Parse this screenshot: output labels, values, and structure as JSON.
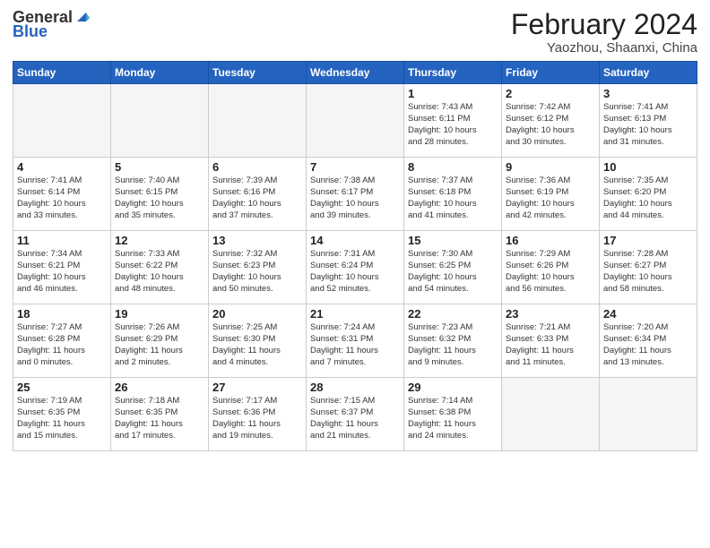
{
  "header": {
    "logo_general": "General",
    "logo_blue": "Blue",
    "title": "February 2024",
    "subtitle": "Yaozhou, Shaanxi, China"
  },
  "days_of_week": [
    "Sunday",
    "Monday",
    "Tuesday",
    "Wednesday",
    "Thursday",
    "Friday",
    "Saturday"
  ],
  "weeks": [
    [
      {
        "day": "",
        "info": "",
        "empty": true
      },
      {
        "day": "",
        "info": "",
        "empty": true
      },
      {
        "day": "",
        "info": "",
        "empty": true
      },
      {
        "day": "",
        "info": "",
        "empty": true
      },
      {
        "day": "1",
        "info": "Sunrise: 7:43 AM\nSunset: 6:11 PM\nDaylight: 10 hours\nand 28 minutes.",
        "empty": false
      },
      {
        "day": "2",
        "info": "Sunrise: 7:42 AM\nSunset: 6:12 PM\nDaylight: 10 hours\nand 30 minutes.",
        "empty": false
      },
      {
        "day": "3",
        "info": "Sunrise: 7:41 AM\nSunset: 6:13 PM\nDaylight: 10 hours\nand 31 minutes.",
        "empty": false
      }
    ],
    [
      {
        "day": "4",
        "info": "Sunrise: 7:41 AM\nSunset: 6:14 PM\nDaylight: 10 hours\nand 33 minutes.",
        "empty": false
      },
      {
        "day": "5",
        "info": "Sunrise: 7:40 AM\nSunset: 6:15 PM\nDaylight: 10 hours\nand 35 minutes.",
        "empty": false
      },
      {
        "day": "6",
        "info": "Sunrise: 7:39 AM\nSunset: 6:16 PM\nDaylight: 10 hours\nand 37 minutes.",
        "empty": false
      },
      {
        "day": "7",
        "info": "Sunrise: 7:38 AM\nSunset: 6:17 PM\nDaylight: 10 hours\nand 39 minutes.",
        "empty": false
      },
      {
        "day": "8",
        "info": "Sunrise: 7:37 AM\nSunset: 6:18 PM\nDaylight: 10 hours\nand 41 minutes.",
        "empty": false
      },
      {
        "day": "9",
        "info": "Sunrise: 7:36 AM\nSunset: 6:19 PM\nDaylight: 10 hours\nand 42 minutes.",
        "empty": false
      },
      {
        "day": "10",
        "info": "Sunrise: 7:35 AM\nSunset: 6:20 PM\nDaylight: 10 hours\nand 44 minutes.",
        "empty": false
      }
    ],
    [
      {
        "day": "11",
        "info": "Sunrise: 7:34 AM\nSunset: 6:21 PM\nDaylight: 10 hours\nand 46 minutes.",
        "empty": false
      },
      {
        "day": "12",
        "info": "Sunrise: 7:33 AM\nSunset: 6:22 PM\nDaylight: 10 hours\nand 48 minutes.",
        "empty": false
      },
      {
        "day": "13",
        "info": "Sunrise: 7:32 AM\nSunset: 6:23 PM\nDaylight: 10 hours\nand 50 minutes.",
        "empty": false
      },
      {
        "day": "14",
        "info": "Sunrise: 7:31 AM\nSunset: 6:24 PM\nDaylight: 10 hours\nand 52 minutes.",
        "empty": false
      },
      {
        "day": "15",
        "info": "Sunrise: 7:30 AM\nSunset: 6:25 PM\nDaylight: 10 hours\nand 54 minutes.",
        "empty": false
      },
      {
        "day": "16",
        "info": "Sunrise: 7:29 AM\nSunset: 6:26 PM\nDaylight: 10 hours\nand 56 minutes.",
        "empty": false
      },
      {
        "day": "17",
        "info": "Sunrise: 7:28 AM\nSunset: 6:27 PM\nDaylight: 10 hours\nand 58 minutes.",
        "empty": false
      }
    ],
    [
      {
        "day": "18",
        "info": "Sunrise: 7:27 AM\nSunset: 6:28 PM\nDaylight: 11 hours\nand 0 minutes.",
        "empty": false
      },
      {
        "day": "19",
        "info": "Sunrise: 7:26 AM\nSunset: 6:29 PM\nDaylight: 11 hours\nand 2 minutes.",
        "empty": false
      },
      {
        "day": "20",
        "info": "Sunrise: 7:25 AM\nSunset: 6:30 PM\nDaylight: 11 hours\nand 4 minutes.",
        "empty": false
      },
      {
        "day": "21",
        "info": "Sunrise: 7:24 AM\nSunset: 6:31 PM\nDaylight: 11 hours\nand 7 minutes.",
        "empty": false
      },
      {
        "day": "22",
        "info": "Sunrise: 7:23 AM\nSunset: 6:32 PM\nDaylight: 11 hours\nand 9 minutes.",
        "empty": false
      },
      {
        "day": "23",
        "info": "Sunrise: 7:21 AM\nSunset: 6:33 PM\nDaylight: 11 hours\nand 11 minutes.",
        "empty": false
      },
      {
        "day": "24",
        "info": "Sunrise: 7:20 AM\nSunset: 6:34 PM\nDaylight: 11 hours\nand 13 minutes.",
        "empty": false
      }
    ],
    [
      {
        "day": "25",
        "info": "Sunrise: 7:19 AM\nSunset: 6:35 PM\nDaylight: 11 hours\nand 15 minutes.",
        "empty": false
      },
      {
        "day": "26",
        "info": "Sunrise: 7:18 AM\nSunset: 6:35 PM\nDaylight: 11 hours\nand 17 minutes.",
        "empty": false
      },
      {
        "day": "27",
        "info": "Sunrise: 7:17 AM\nSunset: 6:36 PM\nDaylight: 11 hours\nand 19 minutes.",
        "empty": false
      },
      {
        "day": "28",
        "info": "Sunrise: 7:15 AM\nSunset: 6:37 PM\nDaylight: 11 hours\nand 21 minutes.",
        "empty": false
      },
      {
        "day": "29",
        "info": "Sunrise: 7:14 AM\nSunset: 6:38 PM\nDaylight: 11 hours\nand 24 minutes.",
        "empty": false
      },
      {
        "day": "",
        "info": "",
        "empty": true
      },
      {
        "day": "",
        "info": "",
        "empty": true
      }
    ]
  ]
}
